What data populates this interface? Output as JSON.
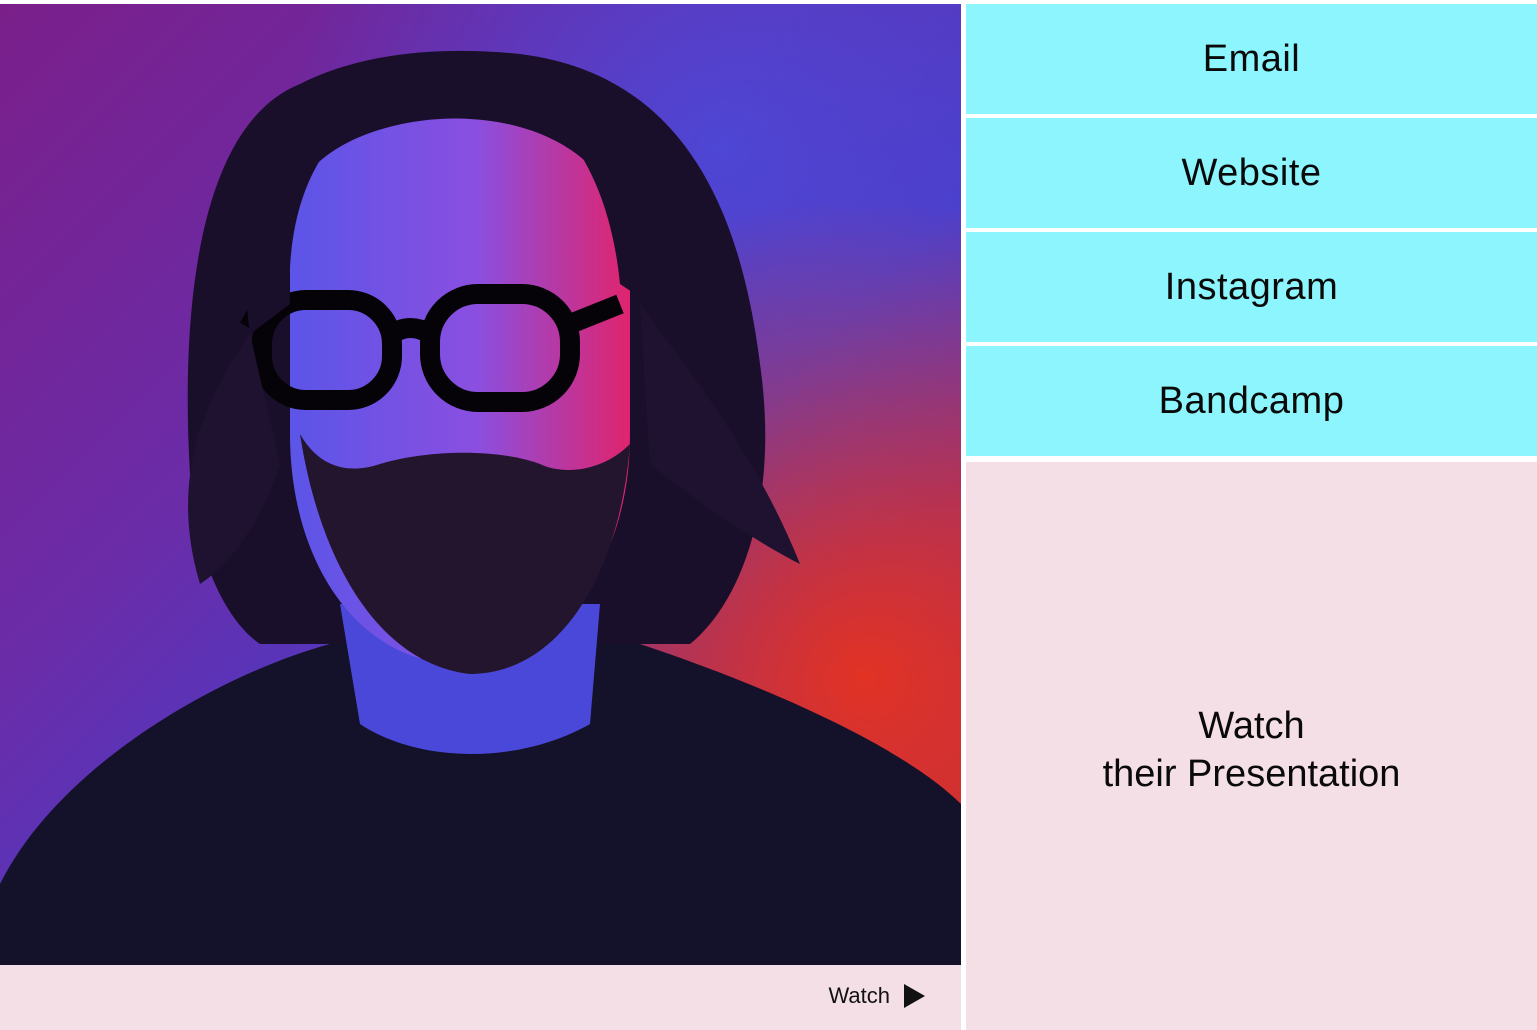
{
  "links": [
    {
      "label": "Email"
    },
    {
      "label": "Website"
    },
    {
      "label": "Instagram"
    },
    {
      "label": "Bandcamp"
    }
  ],
  "presentation": {
    "line1": "Watch",
    "line2": "their Presentation"
  },
  "watch": {
    "label": "Watch",
    "icon": "play-icon"
  },
  "colors": {
    "link_bg": "#8cf5fd",
    "panel_bg": "#f5dfe6",
    "text": "#0a0a0a"
  }
}
